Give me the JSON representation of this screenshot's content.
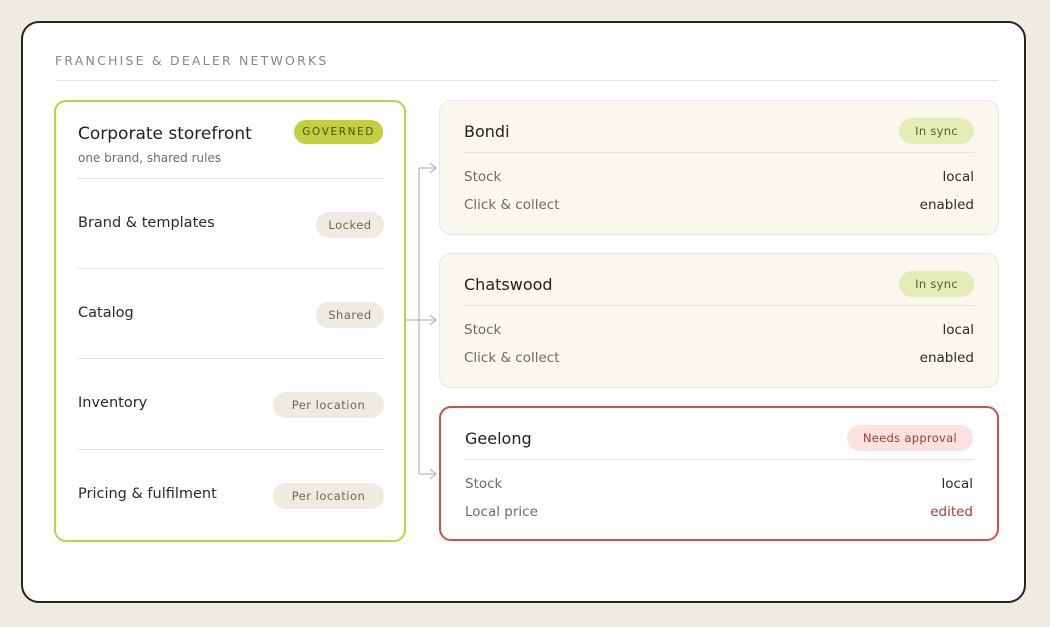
{
  "section_title": "FRANCHISE & DEALER NETWORKS",
  "hub": {
    "title": "Corporate storefront",
    "subtitle": "one brand, shared rules",
    "badge": "GOVERNED",
    "rules": [
      {
        "label": "Brand & templates",
        "status": "Locked"
      },
      {
        "label": "Catalog",
        "status": "Shared"
      },
      {
        "label": "Inventory",
        "status": "Per location"
      },
      {
        "label": "Pricing & fulfilment",
        "status": "Per location"
      }
    ]
  },
  "locations": [
    {
      "name": "Bondi",
      "status": "In sync",
      "rows": [
        {
          "key": "Stock",
          "value": "local"
        },
        {
          "key": "Click & collect",
          "value": "enabled"
        }
      ]
    },
    {
      "name": "Chatswood",
      "status": "In sync",
      "rows": [
        {
          "key": "Stock",
          "value": "local"
        },
        {
          "key": "Click & collect",
          "value": "enabled"
        }
      ]
    },
    {
      "name": "Geelong",
      "status": "Needs approval",
      "rows": [
        {
          "key": "Stock",
          "value": "local"
        },
        {
          "key": "Local price",
          "value": "edited"
        }
      ]
    }
  ],
  "colors": {
    "page_bg": "#efebe1",
    "accent_lime": "#c2cf3f",
    "alert_red": "#d1514a",
    "sync_badge": "#e6ecb6",
    "alert_badge": "#fbe2de"
  }
}
